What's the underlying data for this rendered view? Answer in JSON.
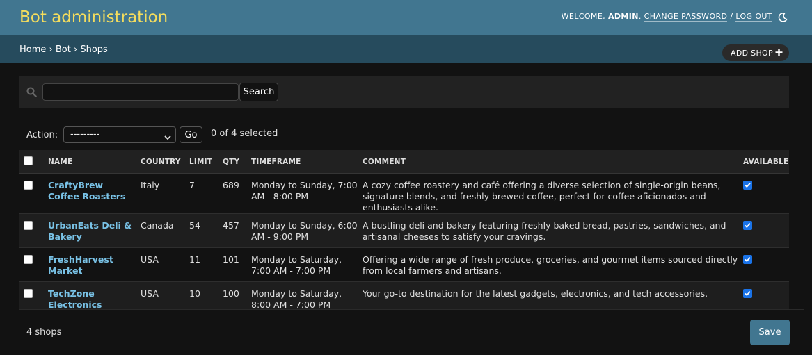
{
  "header": {
    "site_name": "Bot administration",
    "welcome": "Welcome,",
    "username": "admin",
    "change_password": "Change password",
    "separator": "/",
    "log_out": "Log out",
    "theme_icon": "moon-icon"
  },
  "breadcrumbs": {
    "home": "Home",
    "app": "Bot",
    "current": "Shops",
    "sep": "›"
  },
  "add_button": {
    "label": "Add shop",
    "icon": "plus-icon"
  },
  "search": {
    "value": "",
    "placeholder": "",
    "button": "Search",
    "icon": "search-icon"
  },
  "actions": {
    "label": "Action:",
    "selected_option": "---------",
    "go": "Go",
    "selected_text": "0 of 4 selected"
  },
  "table": {
    "columns": [
      "Name",
      "Country",
      "Limit",
      "Qty",
      "Timeframe",
      "Comment",
      "Available"
    ],
    "rows": [
      {
        "name": "CraftyBrew Coffee Roasters",
        "country": "Italy",
        "limit": "7",
        "qty": "689",
        "timeframe": "Monday to Sunday, 7:00 AM - 8:00 PM",
        "comment": "A cozy coffee roastery and café offering a diverse selection of single-origin beans, signature blends, and freshly brewed coffee, perfect for coffee aficionados and enthusiasts alike.",
        "available": true
      },
      {
        "name": "UrbanEats Deli & Bakery",
        "country": "Canada",
        "limit": "54",
        "qty": "457",
        "timeframe": "Monday to Sunday, 6:00 AM - 9:00 PM",
        "comment": "A bustling deli and bakery featuring freshly baked bread, pastries, sandwiches, and artisanal cheeses to satisfy your cravings.",
        "available": true
      },
      {
        "name": "FreshHarvest Market",
        "country": "USA",
        "limit": "11",
        "qty": "101",
        "timeframe": "Monday to Saturday, 7:00 AM - 7:00 PM",
        "comment": "Offering a wide range of fresh produce, groceries, and gourmet items sourced directly from local farmers and artisans.",
        "available": true
      },
      {
        "name": "TechZone Electronics",
        "country": "USA",
        "limit": "10",
        "qty": "100",
        "timeframe": "Monday to Saturday, 8:00 AM - 7:00 PM",
        "comment": "Your go-to destination for the latest gadgets, electronics, and tech accessories.",
        "available": true
      }
    ]
  },
  "footer": {
    "count": "4 shops",
    "save": "Save"
  },
  "colors": {
    "header_bg": "#417690",
    "breadcrumbs_bg": "#264b5d",
    "site_name": "#f5dd5d",
    "link": "#79c2e6",
    "checkbox_checked": "#1a73e8"
  }
}
